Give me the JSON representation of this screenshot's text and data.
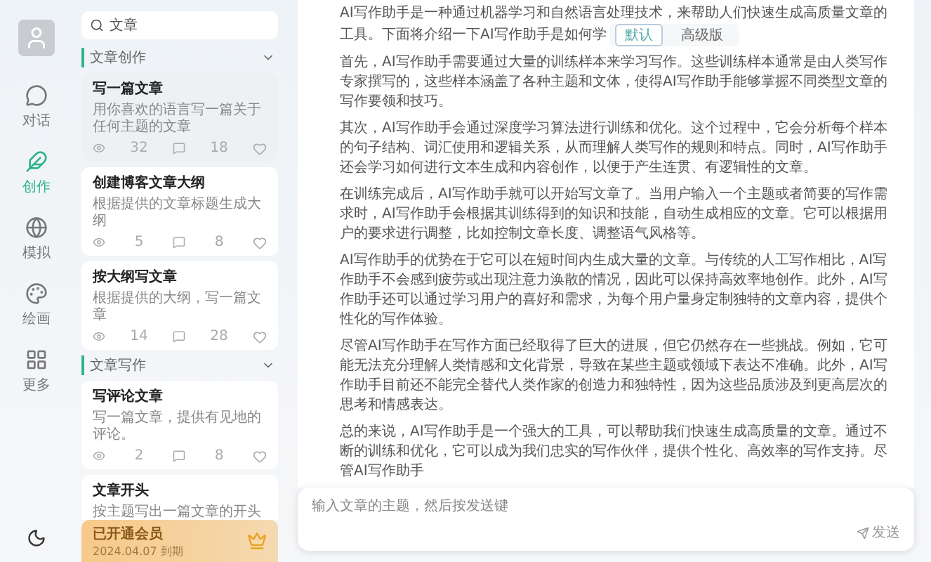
{
  "rail": {
    "items": [
      {
        "label": "对话",
        "selected": false
      },
      {
        "label": "创作",
        "selected": true
      },
      {
        "label": "模拟",
        "selected": false
      },
      {
        "label": "绘画",
        "selected": false
      },
      {
        "label": "更多",
        "selected": false
      }
    ]
  },
  "search": {
    "value": "文章"
  },
  "sections": [
    {
      "title": "文章创作",
      "expanded": true,
      "cards": [
        {
          "title": "写一篇文章",
          "desc": "用你喜欢的语言写一篇关于任何主题的文章",
          "views": "32",
          "uses": "18",
          "selected": true
        },
        {
          "title": "创建博客文章大纲",
          "desc": "根据提供的文章标题生成大纲",
          "views": "5",
          "uses": "8",
          "selected": false
        },
        {
          "title": "按大纲写文章",
          "desc": "根据提供的大纲，写一篇文章",
          "views": "14",
          "uses": "28",
          "selected": false
        }
      ]
    },
    {
      "title": "文章写作",
      "expanded": true,
      "cards": [
        {
          "title": "写评论文章",
          "desc": "写一篇文章，提供有见地的评论。",
          "views": "2",
          "uses": "8",
          "selected": false
        },
        {
          "title": "文章开头",
          "desc": "按主题写出一篇文章的开头",
          "selected": false
        }
      ]
    }
  ],
  "vip": {
    "title": "已开通会员",
    "expiry": "2024.04.07 到期"
  },
  "article": {
    "paragraphs": [
      "AI写作助手是一种通过机器学习和自然语言处理技术，来帮助人们快速生成高质量文章的工具。下面将介绍一下AI写作助手是如何学",
      "首先，AI写作助手需要通过大量的训练样本来学习写作。这些训练样本通常是由人类写作专家撰写的，这些样本涵盖了各种主题和文体，使得AI写作助手能够掌握不同类型文章的写作要领和技巧。",
      "其次，AI写作助手会通过深度学习算法进行训练和优化。这个过程中，它会分析每个样本的句子结构、词汇使用和逻辑关系，从而理解人类写作的规则和特点。同时，AI写作助手还会学习如何进行文本生成和内容创作，以便于产生连贯、有逻辑性的文章。",
      "在训练完成后，AI写作助手就可以开始写文章了。当用户输入一个主题或者简要的写作需求时，AI写作助手会根据其训练得到的知识和技能，自动生成相应的文章。它可以根据用户的要求进行调整，比如控制文章长度、调整语气风格等。",
      "AI写作助手的优势在于它可以在短时间内生成大量的文章。与传统的人工写作相比，AI写作助手不会感到疲劳或出现注意力涣散的情况，因此可以保持高效率地创作。此外，AI写作助手还可以通过学习用户的喜好和需求，为每个用户量身定制独特的文章内容，提供个性化的写作体验。",
      "尽管AI写作助手在写作方面已经取得了巨大的进展，但它仍然存在一些挑战。例如，它可能无法充分理解人类情感和文化背景，导致在某些主题或领域下表达不准确。此外，AI写作助手目前还不能完全替代人类作家的创造力和独特性，因为这些品质涉及到更高层次的思考和情感表达。",
      "总的来说，AI写作助手是一个强大的工具，可以帮助我们快速生成高质量的文章。通过不断的训练和优化，它可以成为我们忠实的写作伙伴，提供个性化、高效率的写作支持。尽管AI写作助手"
    ],
    "mode_options": [
      {
        "label": "默认",
        "selected": true
      },
      {
        "label": "高级版",
        "selected": false
      }
    ]
  },
  "composer": {
    "placeholder": "输入文章的主题，然后按发送键",
    "send": "发送"
  }
}
